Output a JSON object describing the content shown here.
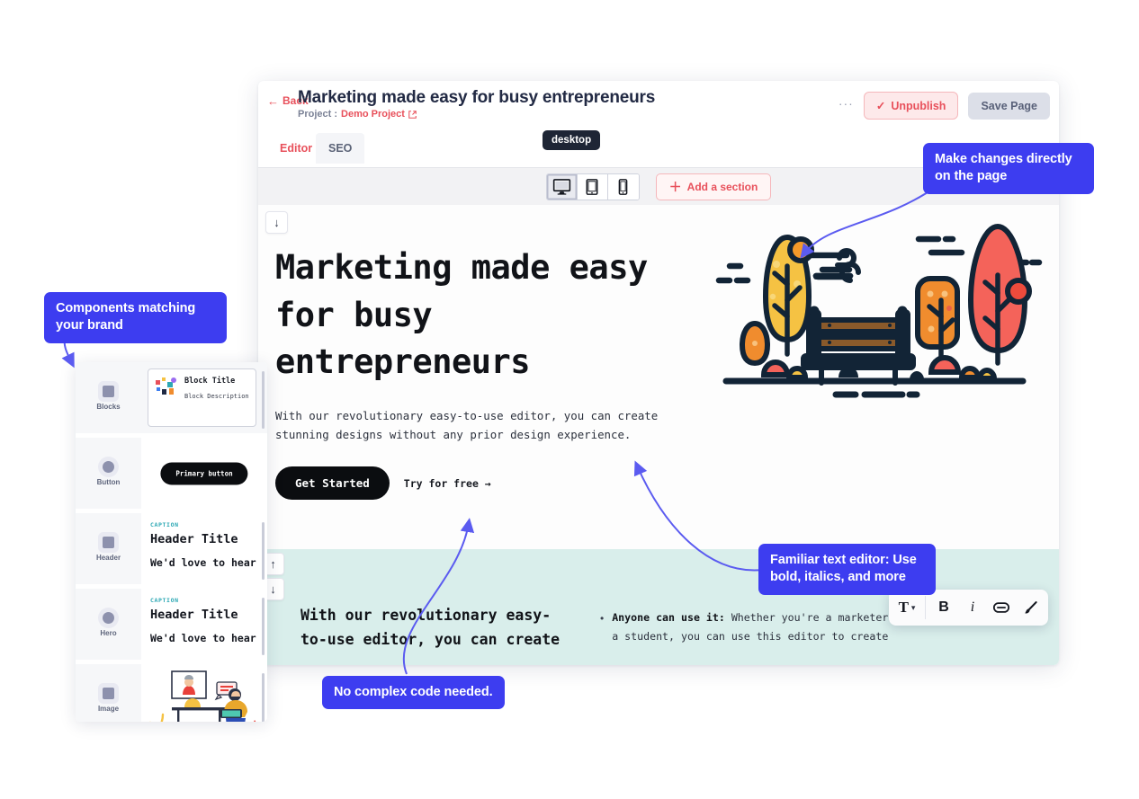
{
  "header": {
    "back_label": "Back",
    "back_icon": "arrow-left-icon",
    "page_title": "Marketing made easy for busy entrepreneurs",
    "project_prefix": "Project :",
    "project_name": "Demo Project",
    "external_link_icon": "external-link-icon",
    "more_dots": "···",
    "unpublish_label": "Unpublish",
    "unpublish_icon": "check-icon",
    "save_label": "Save Page"
  },
  "tabs": [
    {
      "label": "Editor",
      "active": true
    },
    {
      "label": "SEO",
      "active": false
    }
  ],
  "device_bar": {
    "tooltip": "desktop",
    "devices": [
      {
        "name": "desktop-view-button",
        "icon": "monitor-icon",
        "active": true
      },
      {
        "name": "tablet-view-button",
        "icon": "tablet-icon",
        "active": false
      },
      {
        "name": "mobile-view-button",
        "icon": "mobile-icon",
        "active": false
      }
    ],
    "add_section_label": "Add a section",
    "add_section_icon": "plus-icon"
  },
  "canvas": {
    "hero": {
      "move_down_icon": "arrow-down-icon",
      "heading": "Marketing made easy for busy entrepreneurs",
      "paragraph": "With our revolutionary easy-to-use editor, you can create stunning designs without any prior design experience.",
      "primary_cta": "Get Started",
      "secondary_cta": "Try for free →",
      "illustration": "park-bench-autumn-trees-illustration"
    },
    "section_two": {
      "move_up_icon": "arrow-up-icon",
      "move_down_icon": "arrow-down-icon",
      "left_text": "With our revolutionary easy-to-use editor, you can create",
      "bullet_bold": "Anyone can use it:",
      "bullet_rest": " Whether you're a marketer, a business owner, or a student, you can use this editor to create"
    }
  },
  "format_toolbar": {
    "items": [
      {
        "name": "text-style-button",
        "glyph": "T",
        "chevron": "▾"
      },
      {
        "name": "bold-button",
        "glyph": "B"
      },
      {
        "name": "italic-button",
        "glyph": "i"
      },
      {
        "name": "link-button",
        "glyph": "link-icon"
      },
      {
        "name": "highlight-button",
        "glyph": "highlighter-icon"
      }
    ]
  },
  "components_panel": {
    "rows": [
      {
        "label": "Blocks",
        "icon": "square-block-icon",
        "preview_type": "block-card",
        "title": "Block Title",
        "description": "Block Description"
      },
      {
        "label": "Button",
        "icon": "circle-button-icon",
        "preview_type": "button",
        "button_label": "Primary button"
      },
      {
        "label": "Header",
        "icon": "lines-header-icon",
        "preview_type": "text",
        "caption": "CAPTION",
        "heading": "Header Title",
        "subheading": "We'd love to hear"
      },
      {
        "label": "Hero",
        "icon": "hero-icon",
        "preview_type": "text",
        "caption": "CAPTION",
        "heading": "Header Title",
        "subheading": "We'd love to hear"
      },
      {
        "label": "Image",
        "icon": "image-icon",
        "preview_type": "image",
        "image_alt": "person-at-desk-video-call-illustration"
      }
    ]
  },
  "callouts": [
    {
      "name": "callout-make-changes",
      "text": "Make changes directly on the page"
    },
    {
      "name": "callout-components-brand",
      "text": "Components matching your brand"
    },
    {
      "name": "callout-familiar-editor",
      "text": "Familiar text editor: Use bold, italics, and more"
    },
    {
      "name": "callout-no-code",
      "text": "No complex code needed."
    }
  ],
  "colors": {
    "accent_red": "#e8505b",
    "callout_blue": "#3d3df0",
    "title_navy": "#222a44",
    "section_teal": "#d9eeeb",
    "save_gray": "#dcdfe8"
  }
}
